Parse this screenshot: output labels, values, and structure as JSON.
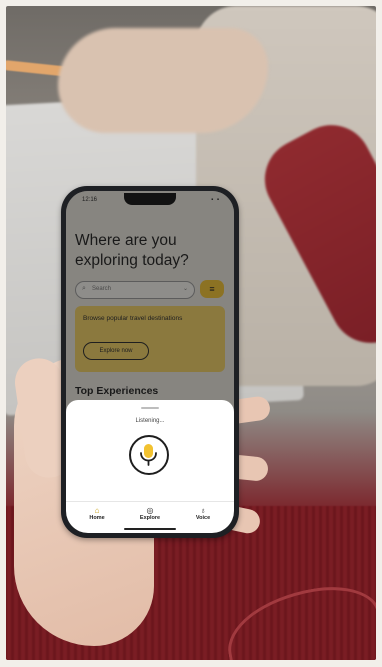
{
  "status_bar": {
    "time": "12:16",
    "battery": "▪ ▪"
  },
  "app": {
    "heading": "Where are you exploring today?",
    "search": {
      "placeholder": "Search",
      "icon": "search-icon"
    },
    "filter_icon": "filter-icon",
    "promo": {
      "text": "Browse popular travel destinations",
      "button": "Explore now"
    },
    "section_title": "Top Experiences"
  },
  "voice_sheet": {
    "status": "Listening...",
    "icon": "microphone-icon",
    "accent_color": "#f2c230"
  },
  "nav": {
    "items": [
      {
        "label": "Home",
        "icon": "home-icon",
        "glyph": "⌂"
      },
      {
        "label": "Explore",
        "icon": "compass-icon",
        "glyph": "◎"
      },
      {
        "label": "Voice",
        "icon": "microphone-icon",
        "glyph": "♁"
      }
    ]
  },
  "colors": {
    "accent": "#f2c230",
    "promo_bg": "#f0cf63",
    "sheet_bg": "#ffffff"
  }
}
